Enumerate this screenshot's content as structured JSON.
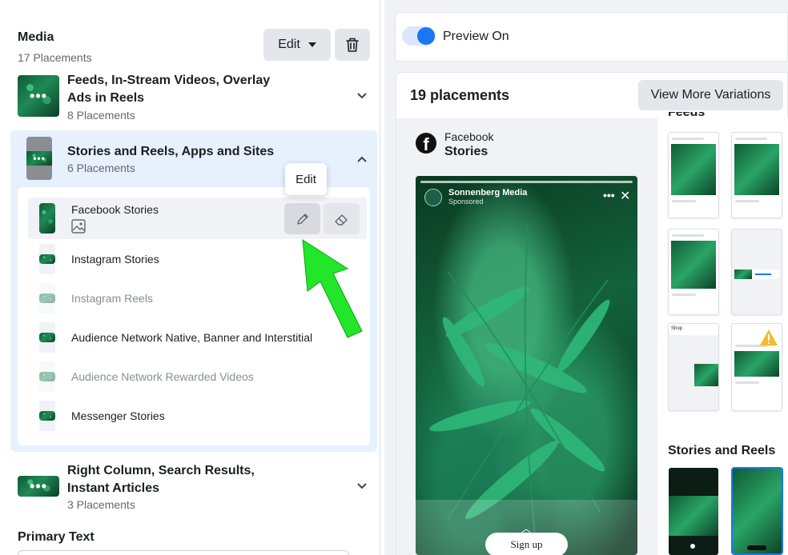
{
  "left": {
    "media_title": "Media",
    "media_count": "17 Placements",
    "edit_button": "Edit",
    "groups": [
      {
        "title_line1": "Feeds, In-Stream Videos, Overlay",
        "title_line2": "Ads in Reels",
        "count": "8 Placements"
      },
      {
        "title_line1": "Stories and Reels, Apps and Sites",
        "count": "6 Placements"
      },
      {
        "title_line1": "Right Column, Search Results,",
        "title_line2": "Instant Articles",
        "count": "3 Placements"
      }
    ],
    "placements": [
      {
        "label": "Facebook Stories",
        "state": "active"
      },
      {
        "label": "Instagram Stories",
        "state": "normal"
      },
      {
        "label": "Instagram Reels",
        "state": "dim"
      },
      {
        "label": "Audience Network Native, Banner and Interstitial",
        "state": "normal"
      },
      {
        "label": "Audience Network Rewarded Videos",
        "state": "dim"
      },
      {
        "label": "Messenger Stories",
        "state": "normal"
      }
    ],
    "tooltip": "Edit",
    "primary_text": "Primary Text"
  },
  "right": {
    "preview_toggle_label": "Preview On",
    "placements_count": "19 placements",
    "view_more_button": "View More Variations",
    "platform": "Facebook",
    "placement": "Stories",
    "story_page_name": "Sonnenberg Media",
    "story_sponsored": "Sponsored",
    "cta": "Sign up",
    "feeds_heading": "Feeds",
    "stories_reels_heading": "Stories and Reels",
    "mini_shop_label": "Shop"
  },
  "colors": {
    "accent": "#1877f2",
    "arrow": "#22e62a",
    "selected_bg": "#e7f0fd"
  }
}
